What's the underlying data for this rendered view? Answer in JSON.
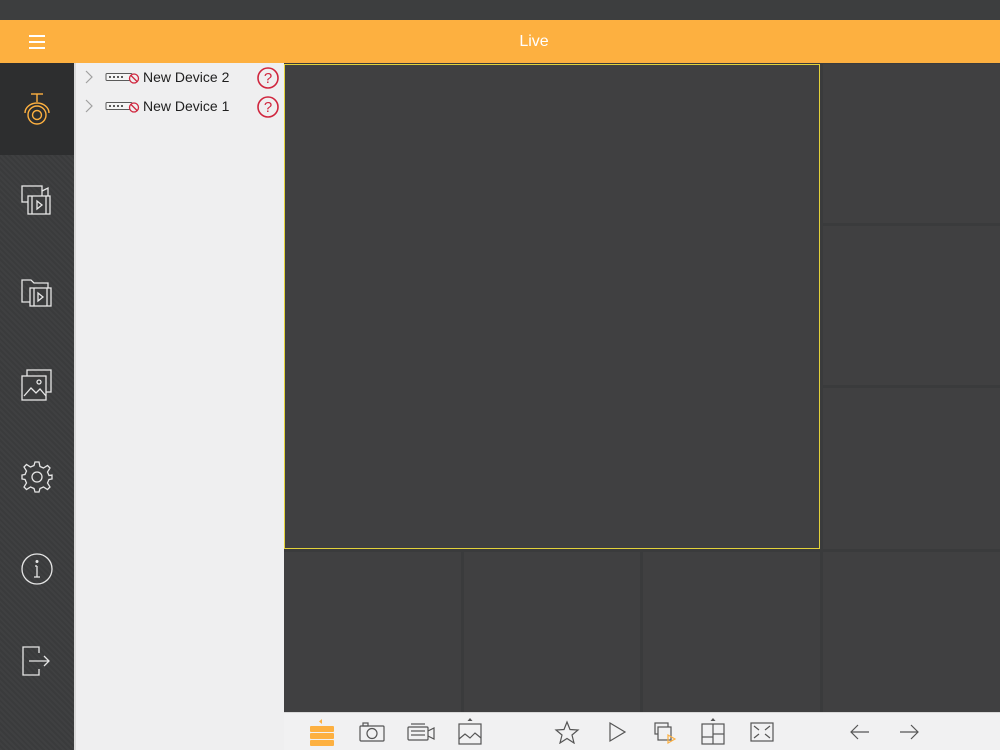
{
  "header": {
    "title": "Live"
  },
  "icons": {
    "menu": "hamburger-menu-icon",
    "nav": [
      "live-view-camera-icon",
      "playback-icon",
      "local-files-icon",
      "pictures-icon",
      "settings-icon",
      "info-icon",
      "logout-icon"
    ],
    "toolbar": [
      "channel-list-icon",
      "capture-icon",
      "record-icon",
      "image-quality-icon",
      "favorites-star-icon",
      "play-icon",
      "instant-playback-icon",
      "window-layout-icon",
      "fullscreen-icon",
      "previous-page-arrow-icon",
      "next-page-arrow-icon"
    ]
  },
  "devices": [
    {
      "name": "New Device 2",
      "status": "?"
    },
    {
      "name": "New Device 1",
      "status": "?"
    }
  ],
  "colors": {
    "accent": "#fdb040",
    "selected_cell_border": "#e3d23a",
    "status_error": "#d0263e"
  }
}
